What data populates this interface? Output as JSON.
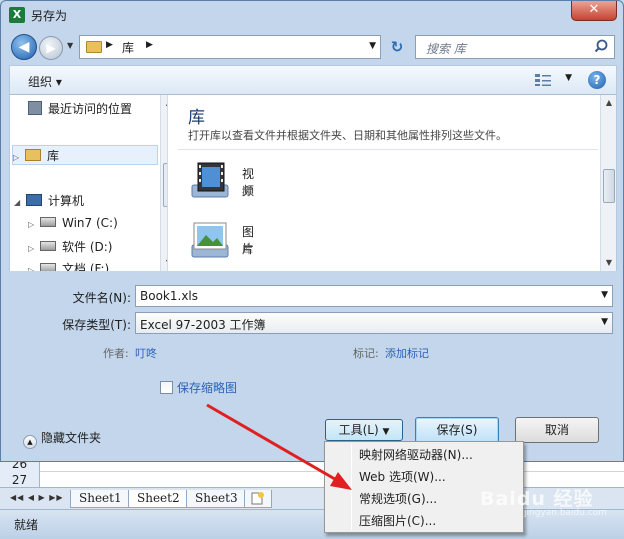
{
  "excel": {
    "rows": [
      "26",
      "27"
    ],
    "sheets": [
      "Sheet1",
      "Sheet2",
      "Sheet3"
    ],
    "active_sheet": "Sheet2",
    "status": "就绪"
  },
  "dialog": {
    "title": "另存为",
    "address": {
      "location": "库"
    },
    "search": {
      "placeholder": "搜索 库"
    },
    "toolbar": {
      "organize": "组织 ▾"
    },
    "nav_pane": {
      "items": [
        {
          "label": "最近访问的位置"
        },
        {
          "label": "库"
        },
        {
          "label": "计算机"
        },
        {
          "label": "Win7 (C:)"
        },
        {
          "label": "软件 (D:)"
        },
        {
          "label": "文档 (F:)"
        }
      ]
    },
    "library": {
      "title": "库",
      "description": "打开库以查看文件并根据文件夹、日期和其他属性排列这些文件。",
      "items": [
        {
          "name": "视频",
          "type": "库"
        },
        {
          "name": "图片",
          "type": "库"
        }
      ]
    },
    "form": {
      "filename_label": "文件名(N):",
      "filename_value": "Book1.xls",
      "filetype_label": "保存类型(T):",
      "filetype_value": "Excel 97-2003 工作簿",
      "author_label": "作者:",
      "author_value": "叮咚",
      "tags_label": "标记:",
      "tags_value": "添加标记",
      "thumbnail_label": "保存缩略图",
      "hide_folders": "隐藏文件夹"
    },
    "buttons": {
      "tools": "工具(L)",
      "save": "保存(S)",
      "cancel": "取消"
    },
    "tools_menu": [
      "映射网络驱动器(N)...",
      "Web 选项(W)...",
      "常规选项(G)...",
      "压缩图片(C)..."
    ]
  },
  "watermark": {
    "text": "Baidu 经验",
    "sub": "jingyan.baidu.com"
  },
  "colors": {
    "annotation_arrow": "#e02020",
    "link": "#2c62b6",
    "title_blue": "#1e3d6e"
  }
}
